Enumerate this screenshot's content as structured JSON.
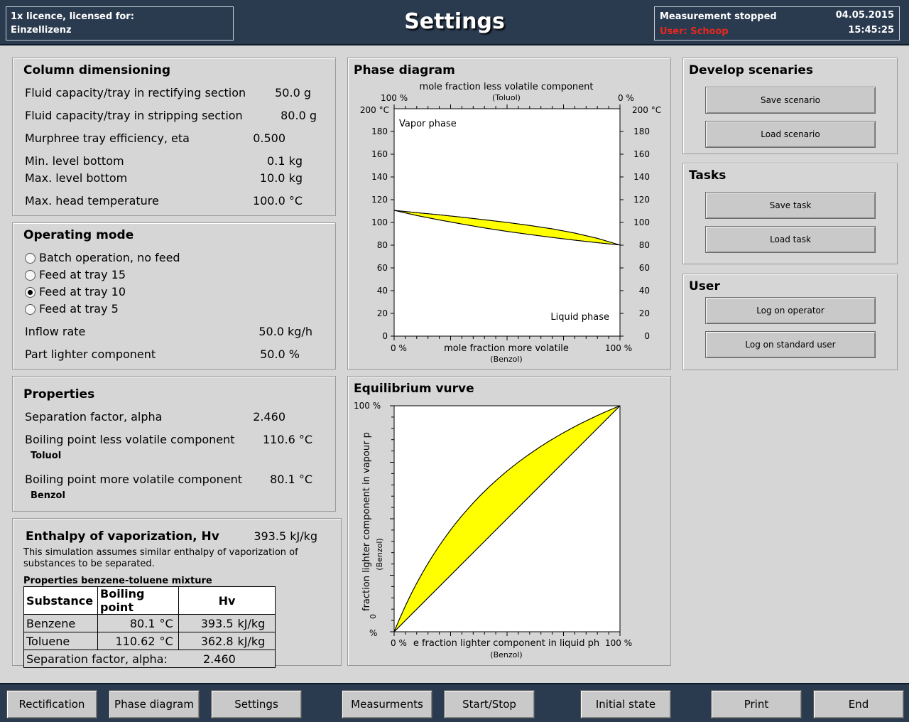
{
  "header": {
    "license_line1": "1x licence, licensed for:",
    "license_line2": "Einzellizenz",
    "title": "Settings",
    "status": "Measurement stopped",
    "user": "User: Schoop",
    "date": "04.05.2015",
    "time": "15:45:25"
  },
  "column_dimensioning": {
    "title": "Column dimensioning",
    "rows": [
      {
        "label": "Fluid capacity/tray in rectifying section",
        "value": "50.0 g"
      },
      {
        "label": "Fluid capacity/tray in stripping section",
        "value": "80.0 g"
      },
      {
        "label": "Murphree tray efficiency, eta",
        "value": "0.500"
      },
      {
        "label": "Min. level bottom",
        "value": "0.1 kg"
      },
      {
        "label": "Max. level bottom",
        "value": "10.0 kg"
      },
      {
        "label": "Max. head temperature",
        "value": "100.0 °C"
      }
    ]
  },
  "operating_mode": {
    "title": "Operating mode",
    "options": [
      {
        "label": "Batch operation, no feed",
        "selected": false
      },
      {
        "label": "Feed at tray 15",
        "selected": false
      },
      {
        "label": "Feed at tray 10",
        "selected": true
      },
      {
        "label": "Feed at tray 5",
        "selected": false
      }
    ],
    "inflow_label": "Inflow rate",
    "inflow_value": "50.0 kg/h",
    "part_label": "Part lighter component",
    "part_value": "50.0 %"
  },
  "properties": {
    "title": "Properties",
    "sep_label": "Separation factor, alpha",
    "sep_value": "2.460",
    "bp_less_label": "Boiling point less volatile component",
    "bp_less_value": "110.6 °C",
    "bp_less_sub": "Toluol",
    "bp_more_label": "Boiling point more volatile component",
    "bp_more_value": "80.1 °C",
    "bp_more_sub": "Benzol"
  },
  "enthalpy": {
    "title": "Enthalpy of vaporization, Hv",
    "value": "393.5 kJ/kg",
    "note_line1": "This simulation assumes similar enthalpy of vaporization of",
    "note_line2": "substances to be separated.",
    "table_title": "Properties benzene-toluene mixture",
    "col_substance": "Substance",
    "col_bp": "Boiling point",
    "col_hv": "Hv",
    "rows": [
      {
        "name": "Benzene",
        "bp": "80.1",
        "bp_unit": "°C",
        "hv": "393.5",
        "hv_unit": "kJ/kg"
      },
      {
        "name": "Toluene",
        "bp": "110.62",
        "bp_unit": "°C",
        "hv": "362.8",
        "hv_unit": "kJ/kg"
      }
    ],
    "footer_label": "Separation factor, alpha:",
    "footer_value": "2.460"
  },
  "phase_diagram": {
    "title": "Phase diagram",
    "top_label": "mole fraction less volatile component",
    "top_sub": "(Toluol)",
    "top_left": "100 %",
    "top_right": "0 %",
    "left_unit": "200 °C",
    "right_unit": "200 °C",
    "bottom_left": "0 %",
    "bottom_label": "mole fraction more volatile",
    "bottom_sub": "(Benzol)",
    "bottom_right": "100 %",
    "vapor_label": "Vapor phase",
    "liquid_label": "Liquid phase",
    "y_ticks": [
      "180",
      "160",
      "140",
      "120",
      "100",
      "80",
      "60",
      "40",
      "20",
      "0"
    ]
  },
  "equilibrium": {
    "title": "Equilibrium vurve",
    "y_top": "100 %",
    "y_bottom": "%",
    "y_label": "fraction lighter component in vapour p",
    "y_sub": "(Benzol)",
    "y_zero": "0",
    "x_left": "0 %",
    "x_label": "e fraction lighter component in liquid ph",
    "x_sub": "(Benzol)",
    "x_right": "100 %"
  },
  "develop": {
    "title": "Develop scenaries",
    "save": "Save scenario",
    "load": "Load scenario"
  },
  "tasks": {
    "title": "Tasks",
    "save": "Save task",
    "load": "Load task"
  },
  "user_panel": {
    "title": "User",
    "operator": "Log on operator",
    "standard": "Log on standard user"
  },
  "footer": {
    "buttons": [
      "Rectification",
      "Phase diagram",
      "Settings",
      "Measurments",
      "Start/Stop",
      "Initial state",
      "Print",
      "End"
    ]
  },
  "chart_data": [
    {
      "type": "area",
      "title": "Phase diagram",
      "xlabel": "mole fraction more volatile",
      "ylabel": "",
      "xlim": [
        0,
        100
      ],
      "ylim": [
        0,
        200
      ],
      "series": [
        {
          "x": [
            0,
            10,
            20,
            30,
            40,
            50,
            60,
            70,
            80,
            90,
            100
          ],
          "y": [
            110.6,
            106.1,
            102.2,
            98.6,
            95.2,
            92.1,
            89.4,
            86.8,
            84.4,
            82.2,
            80.1
          ]
        },
        {
          "x": [
            0,
            10,
            20,
            30,
            40,
            50,
            60,
            70,
            80,
            90,
            100
          ],
          "y": [
            110.6,
            108.6,
            106.7,
            104.6,
            102.3,
            100.0,
            97.3,
            94.4,
            90.6,
            86.0,
            80.1
          ]
        }
      ]
    },
    {
      "type": "area",
      "title": "Equilibrium vurve",
      "xlabel": "e fraction lighter component in liquid ph",
      "ylabel": "fraction lighter component in vapour p",
      "xlim": [
        0,
        100
      ],
      "ylim": [
        0,
        100
      ],
      "alpha": 2.46
    }
  ]
}
